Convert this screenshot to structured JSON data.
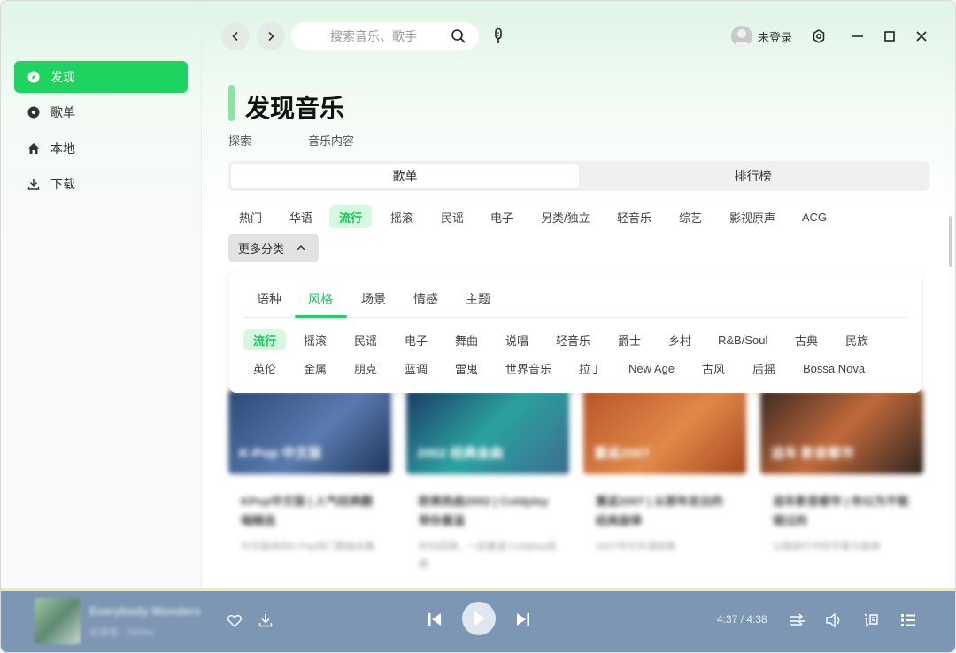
{
  "sidebar": {
    "items": [
      {
        "label": "发现",
        "icon": "compass-icon"
      },
      {
        "label": "歌单",
        "icon": "disc-icon"
      },
      {
        "label": "本地",
        "icon": "home-icon"
      },
      {
        "label": "下载",
        "icon": "download-icon"
      }
    ]
  },
  "topbar": {
    "search_placeholder": "搜索音乐、歌手",
    "user": "未登录"
  },
  "page": {
    "title": "发现音乐",
    "subtitles": [
      "探索",
      "音乐内容"
    ]
  },
  "segments": [
    {
      "label": "歌单",
      "active": true
    },
    {
      "label": "排行榜",
      "active": false
    }
  ],
  "genres": [
    "热门",
    "华语",
    "流行",
    "摇滚",
    "民谣",
    "电子",
    "另类/独立",
    "轻音乐",
    "综艺",
    "影视原声",
    "ACG"
  ],
  "genres_active": "流行",
  "more_button": "更多分类",
  "panel": {
    "tabs": [
      "语种",
      "风格",
      "场景",
      "情感",
      "主题"
    ],
    "active_tab": "风格",
    "row1": [
      "流行",
      "摇滚",
      "民谣",
      "电子",
      "舞曲",
      "说唱",
      "轻音乐",
      "爵士",
      "乡村",
      "R&B/Soul",
      "古典",
      "民族"
    ],
    "row2": [
      "英伦",
      "金属",
      "朋克",
      "蓝调",
      "雷鬼",
      "世界音乐",
      "拉丁",
      "New Age",
      "古风",
      "后摇",
      "Bossa Nova"
    ],
    "active_tag": "流行"
  },
  "cards": [
    {
      "cover_text": "K-Pop 中文版",
      "title": "KPop中文版 | 人气经典翻唱精选",
      "desc": "中文版本的K-Pop热门歌曲合集",
      "color": "#3a5a86"
    },
    {
      "cover_text": "2002 经典金曲",
      "title": "欧美热曲2002 | Coldplay带你重温",
      "desc": "时光回溯，一起重温 Coldplay经典",
      "color": "#2f6e8a"
    },
    {
      "cover_text": "重返2007",
      "title": "重返2007 | 从那年走出的经典旋律",
      "desc": "2007年代华语经典",
      "color": "#c4622e"
    },
    {
      "cover_text": "追车 影音都市",
      "title": "追车影音都市 | 你以为不能错过的",
      "desc": "公路旅行中的节奏与旋律",
      "color": "#5a3a30"
    }
  ],
  "player": {
    "song": "Everybody Wonders",
    "artist": "纪录板 - Sinlee",
    "time": "4:37 / 4:38",
    "progress": 0.996
  }
}
